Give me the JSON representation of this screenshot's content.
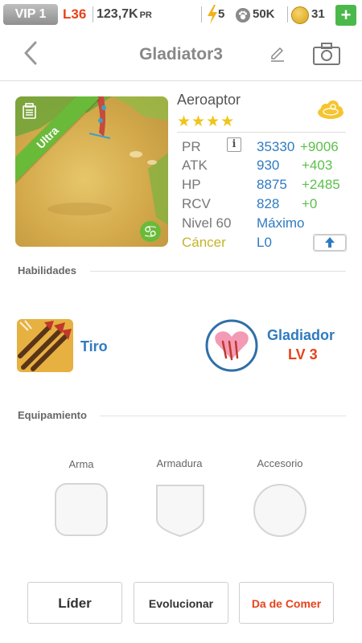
{
  "status_bar": {
    "vip": "VIP 1",
    "level": "L36",
    "power": "123,7K",
    "power_unit": "PR",
    "energy": "5",
    "paw": "50K",
    "coins": "31",
    "add": "+"
  },
  "header": {
    "title": "Gladiator3"
  },
  "card": {
    "rarity": "Ultra",
    "zodiac_symbol": "♋"
  },
  "pet": {
    "name": "Aeroaptor",
    "stars": "★★★★",
    "star_count": 4
  },
  "stats": {
    "pr": {
      "label": "PR",
      "value": "35330",
      "bonus": "+9006"
    },
    "atk": {
      "label": "ATK",
      "value": "930",
      "bonus": "+403"
    },
    "hp": {
      "label": "HP",
      "value": "8875",
      "bonus": "+2485"
    },
    "rcv": {
      "label": "RCV",
      "value": "828",
      "bonus": "+0"
    },
    "level": {
      "label": "Nivel 60",
      "value": "Máximo"
    },
    "zodiac": {
      "label": "Cáncer",
      "value": "L0"
    }
  },
  "info_glyph": "i",
  "skills": {
    "title": "Habilidades",
    "skill1": {
      "name": "Tiro"
    },
    "skill2": {
      "name": "Gladiador",
      "level": "LV 3"
    }
  },
  "equipment": {
    "title": "Equipamiento",
    "weapon": "Arma",
    "armor": "Armadura",
    "accessory": "Accesorio"
  },
  "actions": {
    "leader": "Líder",
    "evolve": "Evolucionar",
    "feed": "Da de Comer"
  },
  "colors": {
    "accent_blue": "#2f7bc0",
    "bonus_green": "#5cc04a",
    "level_red": "#e8421a",
    "ribbon_green": "#6aba3a"
  }
}
